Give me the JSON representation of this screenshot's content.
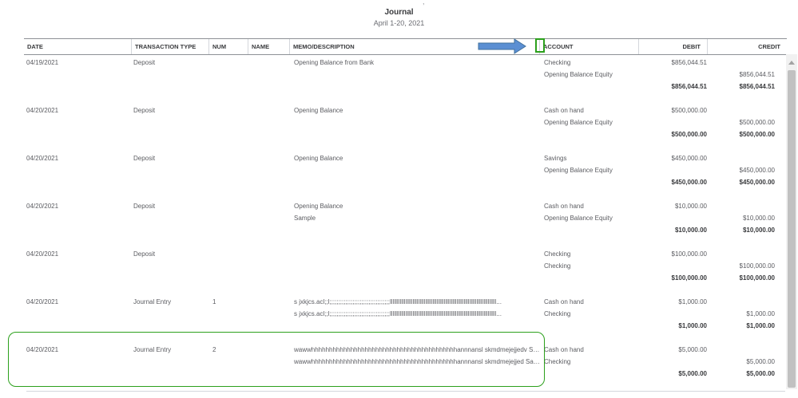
{
  "report": {
    "top_clipped_char": ",",
    "title": "Journal",
    "subtitle": "April 1-20, 2021"
  },
  "columns": {
    "date": "DATE",
    "type": "TRANSACTION TYPE",
    "num": "NUM",
    "name": "NAME",
    "memo": "MEMO/DESCRIPTION",
    "account": "ACCOUNT",
    "debit": "DEBIT",
    "credit": "CREDIT"
  },
  "transactions": [
    {
      "date": "04/19/2021",
      "type": "Deposit",
      "num": "",
      "lines": [
        {
          "memo": "Opening Balance from Bank",
          "account": "Checking",
          "debit": "$856,044.51",
          "credit": ""
        },
        {
          "memo": "",
          "account": "Opening Balance Equity",
          "debit": "",
          "credit": "$856,044.51"
        }
      ],
      "total_debit": "$856,044.51",
      "total_credit": "$856,044.51"
    },
    {
      "date": "04/20/2021",
      "type": "Deposit",
      "num": "",
      "lines": [
        {
          "memo": "Opening Balance",
          "account": "Cash on hand",
          "debit": "$500,000.00",
          "credit": ""
        },
        {
          "memo": "",
          "account": "Opening Balance Equity",
          "debit": "",
          "credit": "$500,000.00"
        }
      ],
      "total_debit": "$500,000.00",
      "total_credit": "$500,000.00"
    },
    {
      "date": "04/20/2021",
      "type": "Deposit",
      "num": "",
      "lines": [
        {
          "memo": "Opening Balance",
          "account": "Savings",
          "debit": "$450,000.00",
          "credit": ""
        },
        {
          "memo": "",
          "account": "Opening Balance Equity",
          "debit": "",
          "credit": "$450,000.00"
        }
      ],
      "total_debit": "$450,000.00",
      "total_credit": "$450,000.00"
    },
    {
      "date": "04/20/2021",
      "type": "Deposit",
      "num": "",
      "lines": [
        {
          "memo": "Opening Balance",
          "account": "Cash on hand",
          "debit": "$10,000.00",
          "credit": ""
        },
        {
          "memo": "Sample",
          "account": "Opening Balance Equity",
          "debit": "",
          "credit": "$10,000.00"
        }
      ],
      "total_debit": "$10,000.00",
      "total_credit": "$10,000.00"
    },
    {
      "date": "04/20/2021",
      "type": "Deposit",
      "num": "",
      "lines": [
        {
          "memo": "",
          "account": "Checking",
          "debit": "$100,000.00",
          "credit": ""
        },
        {
          "memo": "",
          "account": "Checking",
          "debit": "",
          "credit": "$100,000.00"
        }
      ],
      "total_debit": "$100,000.00",
      "total_credit": "$100,000.00"
    },
    {
      "date": "04/20/2021",
      "type": "Journal Entry",
      "num": "1",
      "lines": [
        {
          "memo": "s jxkjcs.acl;;l;;;;;;;;;;;;;;;;;;;;;;;;;;;;;;;;;;lllllllllllllllllllllllllllllllllllllllllllllllllllllllllllllllllllllllllll...",
          "account": "Cash on hand",
          "debit": "$1,000.00",
          "credit": ""
        },
        {
          "memo": "s jxkjcs.acl;;l;;;;;;;;;;;;;;;;;;;;;;;;;;;;;;;;;;lllllllllllllllllllllllllllllllllllllllllllllllllllllllllllllllllllllllllll...",
          "account": "Checking",
          "debit": "",
          "credit": "$1,000.00"
        }
      ],
      "total_debit": "$1,000.00",
      "total_credit": "$1,000.00"
    },
    {
      "date": "04/20/2021",
      "type": "Journal Entry",
      "num": "2",
      "lines": [
        {
          "memo": "wawwhhhhhhhhhhhhhhhhhhhhhhhhhhhhhhhhhhhhhhhhhannnansl skmdmejejjedv Sample",
          "account": "Cash on hand",
          "debit": "$5,000.00",
          "credit": ""
        },
        {
          "memo": "wawwhhhhhhhhhhhhhhhhhhhhhhhhhhhhhhhhhhhhhhhhhannnansl skmdmejejjed Sample",
          "account": "Checking",
          "debit": "",
          "credit": "$5,000.00"
        }
      ],
      "total_debit": "$5,000.00",
      "total_credit": "$5,000.00"
    }
  ],
  "annotations": {
    "arrow_color": "#5b8fd3",
    "highlight_color": "#2ca01c"
  }
}
